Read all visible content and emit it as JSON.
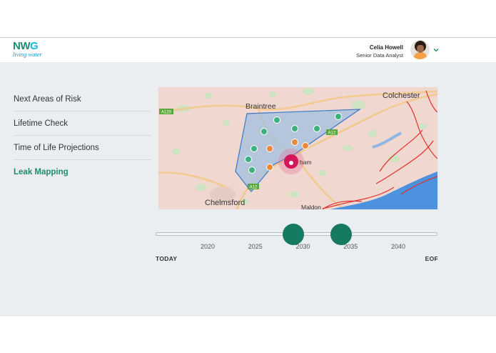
{
  "header": {
    "logo_main_a": "NW",
    "logo_main_b": "G",
    "logo_tagline": "living water",
    "user_name": "Celia Howell",
    "user_role": "Senior Data Analyst"
  },
  "sidebar": {
    "items": [
      {
        "label": "Next Areas of Risk",
        "active": false
      },
      {
        "label": "Lifetime Check",
        "active": false
      },
      {
        "label": "Time of Life Projections",
        "active": false
      },
      {
        "label": "Leak Mapping",
        "active": true
      }
    ]
  },
  "map": {
    "places": {
      "braintree": "Braintree",
      "colchester": "Colchester",
      "chelmsford": "Chelmsford",
      "maldon": "Maldon",
      "witham": "ham"
    },
    "roads": {
      "a120": "A120",
      "a12_north": "A12",
      "a12_south": "A12"
    },
    "colors": {
      "green_point": "#3bb27e",
      "orange_point": "#e98a3a",
      "hotspot": "#d3185a",
      "polygon_fill": "#9ebfe0",
      "polygon_stroke": "#3a78c8",
      "water": "#4c92de",
      "land": "#f0d7cf"
    }
  },
  "timeline": {
    "years": [
      "2020",
      "2025",
      "2030",
      "2035",
      "2040"
    ],
    "start_label": "TODAY",
    "end_label": "EOF",
    "handle_positions_years": [
      2029,
      2034
    ],
    "accent_color": "#167a63"
  }
}
